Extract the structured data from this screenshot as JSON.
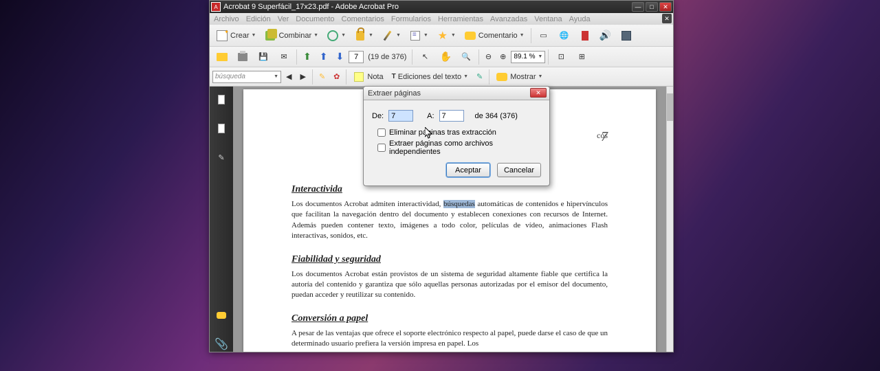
{
  "titlebar": {
    "title": "Acrobat 9 Superfácil_17x23.pdf - Adobe Acrobat Pro"
  },
  "menubar": {
    "items": [
      "Archivo",
      "Edición",
      "Ver",
      "Documento",
      "Comentarios",
      "Formularios",
      "Herramientas",
      "Avanzadas",
      "Ventana",
      "Ayuda"
    ]
  },
  "toolbar1": {
    "create": "Crear",
    "combine": "Combinar",
    "comment": "Comentario"
  },
  "toolbar2": {
    "page_current": "7",
    "page_info": "(19 de 376)",
    "zoom": "89.1 %"
  },
  "toolbar3": {
    "search_placeholder": "búsqueda",
    "note": "Nota",
    "ediciones": "Ediciones del texto",
    "mostrar": "Mostrar"
  },
  "document": {
    "header_right": "cos",
    "page_number": "7",
    "h1": "Interactivida",
    "p1a": "Los documentos Acrobat admiten interactividad, ",
    "p1_highlight": "búsquedas",
    "p1b": " automáticas de contenidos e hipervínculos que facilitan la navegación dentro del documento y establecen conexiones con recursos de Internet. Además pueden contener texto, imágenes a todo color, películas de vídeo, animaciones Flash interactivas, sonidos, etc.",
    "h2": "Fiabilidad y seguridad",
    "p2": "Los documentos Acrobat están provistos de un sistema de seguridad altamente fiable que certifica la autoría del contenido y garantiza que sólo aquellas personas autorizadas por el emisor del documento, puedan acceder y reutilizar su contenido.",
    "h3": "Conversión a papel",
    "p3": "A pesar de las ventajas que ofrece el soporte electrónico respecto al papel, puede darse el caso de que un determinado usuario prefiera la versión impresa en papel. Los"
  },
  "dialog": {
    "title": "Extraer páginas",
    "de_label": "De:",
    "de_value": "7",
    "a_label": "A:",
    "a_value": "7",
    "total": "de 364 (376)",
    "chk1": "Eliminar páginas tras extracción",
    "chk2": "Extraer páginas como archivos independientes",
    "ok": "Aceptar",
    "cancel": "Cancelar"
  }
}
